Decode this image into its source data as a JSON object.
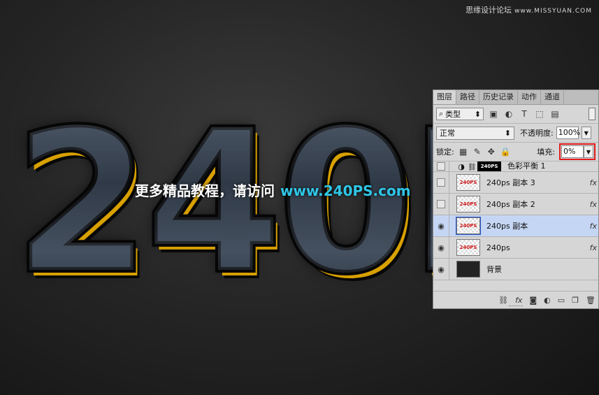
{
  "watermark": {
    "text": "思缘设计论坛",
    "site": "www.MISSYUAN.COM"
  },
  "artwork": {
    "text": "240P"
  },
  "tutorial": {
    "text": "更多精品教程，请访问",
    "url": "www.240PS.com"
  },
  "panel": {
    "tabs": [
      "图层",
      "路径",
      "历史记录",
      "动作",
      "通道"
    ],
    "filter": {
      "label": "类型",
      "icons": [
        "image-icon",
        "adjustment-icon",
        "text-icon",
        "shape-icon",
        "smart-object-icon"
      ]
    },
    "blend_mode": "正常",
    "opacity_label": "不透明度:",
    "opacity_value": "100%",
    "lock_label": "锁定:",
    "fill_label": "填充:",
    "fill_value": "0%",
    "layers": [
      {
        "name": "色彩平衡 1",
        "visible": false,
        "type": "adjustment",
        "mask_text": "240PS"
      },
      {
        "name": "240ps 副本 3",
        "visible": false,
        "thumb": "240PS",
        "fx": "fx"
      },
      {
        "name": "240ps 副本 2",
        "visible": false,
        "thumb": "240PS",
        "fx": "fx"
      },
      {
        "name": "240ps 副本",
        "visible": true,
        "thumb": "240PS",
        "fx": "fx",
        "selected": true
      },
      {
        "name": "240ps",
        "visible": true,
        "thumb": "240PS",
        "fx": "fx"
      },
      {
        "name": "背景",
        "visible": true,
        "thumb": ""
      }
    ],
    "footer_icons": [
      "link-icon",
      "fx-icon",
      "mask-icon",
      "adjustment-icon",
      "folder-icon",
      "new-layer-icon",
      "trash-icon"
    ]
  },
  "colors": {
    "accent_gold": "#d8a000",
    "url_cyan": "#2fc6e6",
    "highlight_red": "#e31b1b",
    "selected_row": "#c5d6f4"
  }
}
